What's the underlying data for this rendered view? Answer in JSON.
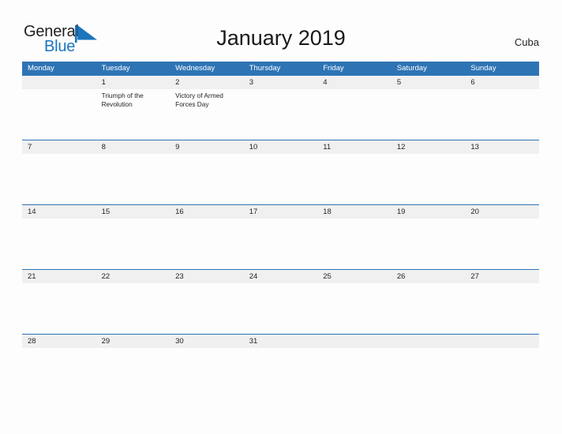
{
  "header": {
    "logo": {
      "word_one": "General",
      "word_two": "Blue",
      "flag_icon": "blue-flag-triangle-icon",
      "word_one_color": "#231f20",
      "word_two_color": "#1b75bc",
      "flag_color": "#1b75bc"
    },
    "title": "January 2019",
    "country": "Cuba"
  },
  "theme": {
    "header_blue": "#2e74b5",
    "date_band_gray": "#f0f0f0",
    "page_background": "#fdfdfd",
    "text_color": "#231f20",
    "row_divider": "#2e74b5"
  },
  "calendar": {
    "weekdays": [
      "Monday",
      "Tuesday",
      "Wednesday",
      "Thursday",
      "Friday",
      "Saturday",
      "Sunday"
    ],
    "weeks": [
      [
        {
          "date": "",
          "event": ""
        },
        {
          "date": "1",
          "event": "Triumph of the Revolution"
        },
        {
          "date": "2",
          "event": "Victory of Armed Forces Day"
        },
        {
          "date": "3",
          "event": ""
        },
        {
          "date": "4",
          "event": ""
        },
        {
          "date": "5",
          "event": ""
        },
        {
          "date": "6",
          "event": ""
        }
      ],
      [
        {
          "date": "7",
          "event": ""
        },
        {
          "date": "8",
          "event": ""
        },
        {
          "date": "9",
          "event": ""
        },
        {
          "date": "10",
          "event": ""
        },
        {
          "date": "11",
          "event": ""
        },
        {
          "date": "12",
          "event": ""
        },
        {
          "date": "13",
          "event": ""
        }
      ],
      [
        {
          "date": "14",
          "event": ""
        },
        {
          "date": "15",
          "event": ""
        },
        {
          "date": "16",
          "event": ""
        },
        {
          "date": "17",
          "event": ""
        },
        {
          "date": "18",
          "event": ""
        },
        {
          "date": "19",
          "event": ""
        },
        {
          "date": "20",
          "event": ""
        }
      ],
      [
        {
          "date": "21",
          "event": ""
        },
        {
          "date": "22",
          "event": ""
        },
        {
          "date": "23",
          "event": ""
        },
        {
          "date": "24",
          "event": ""
        },
        {
          "date": "25",
          "event": ""
        },
        {
          "date": "26",
          "event": ""
        },
        {
          "date": "27",
          "event": ""
        }
      ],
      [
        {
          "date": "28",
          "event": ""
        },
        {
          "date": "29",
          "event": ""
        },
        {
          "date": "30",
          "event": ""
        },
        {
          "date": "31",
          "event": ""
        },
        {
          "date": "",
          "event": ""
        },
        {
          "date": "",
          "event": ""
        },
        {
          "date": "",
          "event": ""
        }
      ]
    ]
  }
}
